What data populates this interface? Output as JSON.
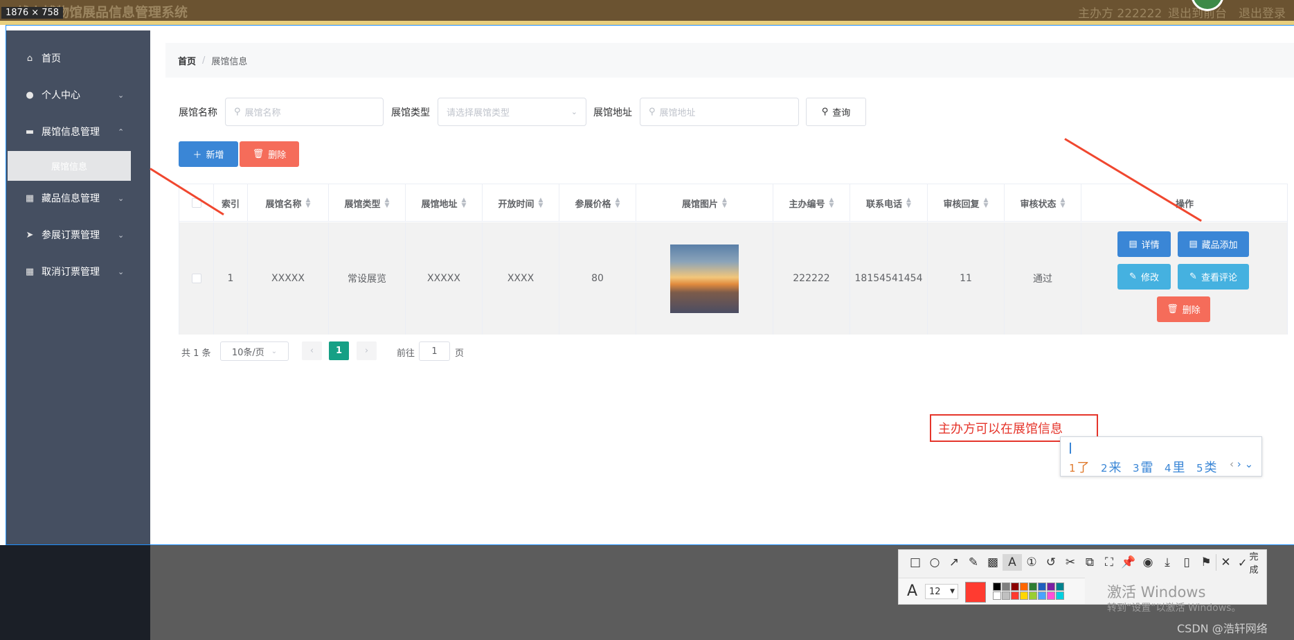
{
  "header": {
    "title": "线上博物馆展品信息管理系统",
    "role_text": "主办方 222222",
    "back_front": "退出到前台",
    "logout": "退出登录",
    "size_badge": "1876 × 758"
  },
  "sidebar": {
    "items": [
      {
        "label": "首页",
        "icon": "home-icon"
      },
      {
        "label": "个人中心",
        "icon": "user-icon"
      },
      {
        "label": "展馆信息管理",
        "icon": "ticket-icon"
      },
      {
        "label": "藏品信息管理",
        "icon": "grid-icon"
      },
      {
        "label": "参展订票管理",
        "icon": "send-icon"
      },
      {
        "label": "取消订票管理",
        "icon": "grid-icon"
      }
    ],
    "sub_item": "展馆信息"
  },
  "breadcrumb": {
    "home": "首页",
    "sep": "/",
    "current": "展馆信息"
  },
  "filters": {
    "name_label": "展馆名称",
    "name_placeholder": "展馆名称",
    "type_label": "展馆类型",
    "type_placeholder": "请选择展馆类型",
    "addr_label": "展馆地址",
    "addr_placeholder": "展馆地址",
    "query_btn": "查询"
  },
  "actions": {
    "add": "新增",
    "delete": "删除"
  },
  "table": {
    "headers": [
      "索引",
      "展馆名称",
      "展馆类型",
      "展馆地址",
      "开放时间",
      "参展价格",
      "展馆图片",
      "主办编号",
      "联系电话",
      "审核回复",
      "审核状态",
      "操作"
    ],
    "rows": [
      {
        "index": "1",
        "name": "XXXXX",
        "type": "常设展览",
        "address": "XXXXX",
        "open_time": "XXXX",
        "price": "80",
        "organizer_no": "222222",
        "phone": "18154541454",
        "review_reply": "11",
        "review_status": "通过"
      }
    ],
    "row_buttons": {
      "detail": "详情",
      "add_item": "藏品添加",
      "edit": "修改",
      "comments": "查看评论",
      "delete": "删除"
    }
  },
  "pagination": {
    "total": "共 1 条",
    "page_size": "10条/页",
    "current_page": "1",
    "goto_prefix": "前往",
    "goto_value": "1",
    "goto_suffix": "页"
  },
  "annotation": {
    "text": "主办方可以在展馆信息"
  },
  "ime": {
    "candidates": [
      {
        "n": "1",
        "c": "了"
      },
      {
        "n": "2",
        "c": "来"
      },
      {
        "n": "3",
        "c": "雷"
      },
      {
        "n": "4",
        "c": "里"
      },
      {
        "n": "5",
        "c": "类"
      }
    ]
  },
  "screenshot_toolbar": {
    "font_size": "12",
    "done_label": "完成"
  },
  "watermarks": {
    "activate_title": "激活 Windows",
    "activate_sub": "转到“设置”以激活 Windows。",
    "csdn": "CSDN @浩轩网络"
  },
  "colors": {
    "header_bg": "#6b5331",
    "sidebar_bg": "#454f61",
    "primary": "#3a86d6",
    "danger": "#f56c5a",
    "info": "#45b1e0",
    "page_active": "#16a085",
    "annotation_red": "#e5352b"
  }
}
